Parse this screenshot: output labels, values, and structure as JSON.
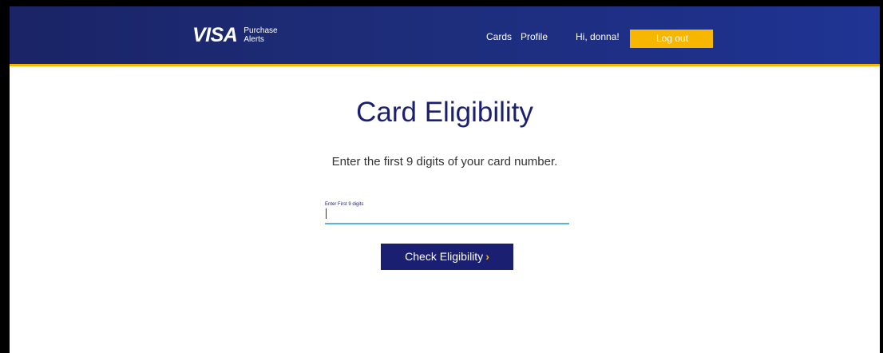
{
  "header": {
    "logo": {
      "brand": "VISA",
      "sub_line1": "Purchase",
      "sub_line2": "Alerts"
    },
    "nav": {
      "cards": "Cards",
      "profile": "Profile"
    },
    "greeting": "Hi, donna!",
    "logout_label": "Log out"
  },
  "main": {
    "title": "Card Eligibility",
    "subtitle": "Enter the first 9 digits of your card number.",
    "field": {
      "label": "Enter First 9 digits",
      "value": "",
      "placeholder": ""
    },
    "check_button": {
      "label": "Check Eligibility",
      "chevron": "›"
    }
  },
  "colors": {
    "header_bg": "#1e2d7a",
    "accent": "#f7b600",
    "primary": "#1a1f71",
    "input_underline": "#5bb2e0"
  },
  "icons": {
    "button_chevron": "chevron-right-icon"
  }
}
